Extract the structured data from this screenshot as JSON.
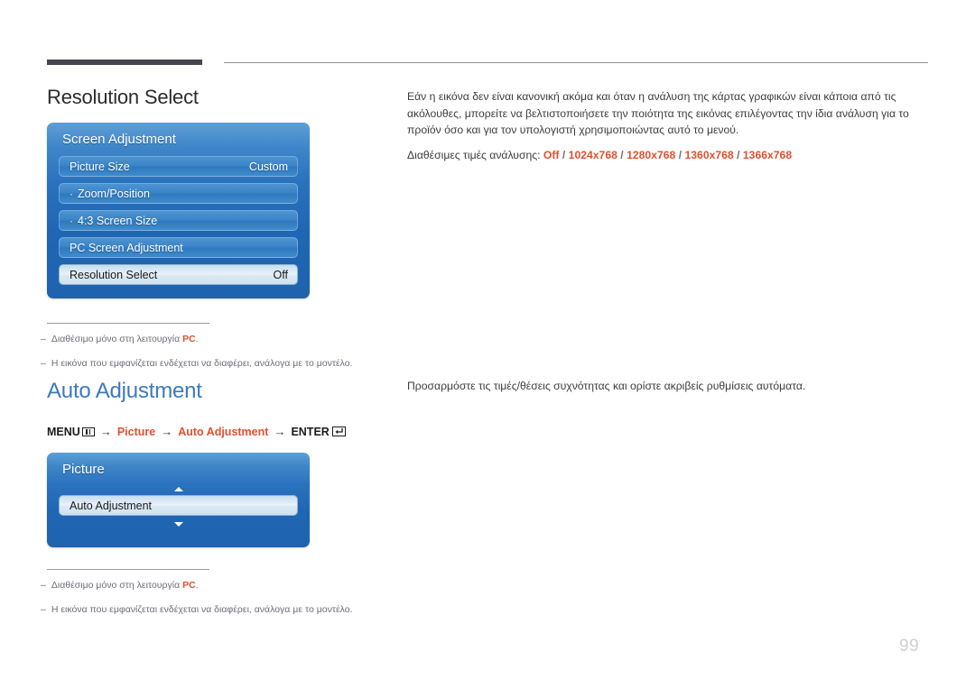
{
  "page": {
    "number": "99"
  },
  "sections": [
    {
      "title": "Resolution Select",
      "title_color": "#2b2b2b",
      "paragraph": "Εάν η εικόνα δεν είναι κανονική ακόμα και όταν η ανάλυση της κάρτας γραφικών είναι κάποια από τις ακόλουθες, μπορείτε να βελτιστοποιήσετε την ποιότητα της εικόνας επιλέγοντας την ίδια ανάλυση για το προϊόν όσο και για τον υπολογιστή χρησιμοποιώντας αυτό το μενού.",
      "available_label": "Διαθέσιμες τιμές ανάλυσης:",
      "available_values": [
        "Off",
        "1024x768",
        "1280x768",
        "1360x768",
        "1366x768"
      ],
      "separator": "/"
    },
    {
      "title": "Auto Adjustment",
      "title_color": "#3d79bd",
      "paragraph": "Προσαρμόστε τις τιμές/θέσεις συχνότητας και ορίστε ακριβείς ρυθμίσεις αυτόματα."
    }
  ],
  "breadcrumb": {
    "menu_label": "MENU",
    "menu_icon": "menu-grid-icon",
    "step1": "Picture",
    "step2": "Auto Adjustment",
    "enter_label": "ENTER",
    "enter_icon": "enter-return-icon",
    "arrow": "→"
  },
  "osd_screen_adjustment": {
    "title": "Screen Adjustment",
    "rows": [
      {
        "bullet": "",
        "label": "Picture Size",
        "value": "Custom",
        "selected": false
      },
      {
        "bullet": "·",
        "label": "Zoom/Position",
        "value": "",
        "selected": false
      },
      {
        "bullet": "·",
        "label": "4:3 Screen Size",
        "value": "",
        "selected": false
      },
      {
        "bullet": "",
        "label": "PC Screen Adjustment",
        "value": "",
        "selected": false
      },
      {
        "bullet": "",
        "label": "Resolution Select",
        "value": "Off",
        "selected": true
      }
    ]
  },
  "osd_picture": {
    "title": "Picture",
    "arrow_up_icon": "triangle-up-icon",
    "arrow_down_icon": "triangle-down-icon",
    "rows": [
      {
        "bullet": "",
        "label": "Auto Adjustment",
        "value": "",
        "selected": true
      }
    ]
  },
  "footnotes": [
    {
      "dash": "–",
      "text_before": "Διαθέσιμο μόνο στη λειτουργία ",
      "accent": "PC",
      "text_after": "."
    },
    {
      "dash": "–",
      "text_before": "Η εικόνα που εμφανίζεται ενδέχεται να διαφέρει, ανάλογα με το μοντέλο.",
      "accent": "",
      "text_after": ""
    }
  ],
  "colors": {
    "accent_orange": "#e1502f",
    "heading_blue": "#3d79bd",
    "osd_blue": "#1f66b4",
    "rule_dark": "#46454f"
  }
}
